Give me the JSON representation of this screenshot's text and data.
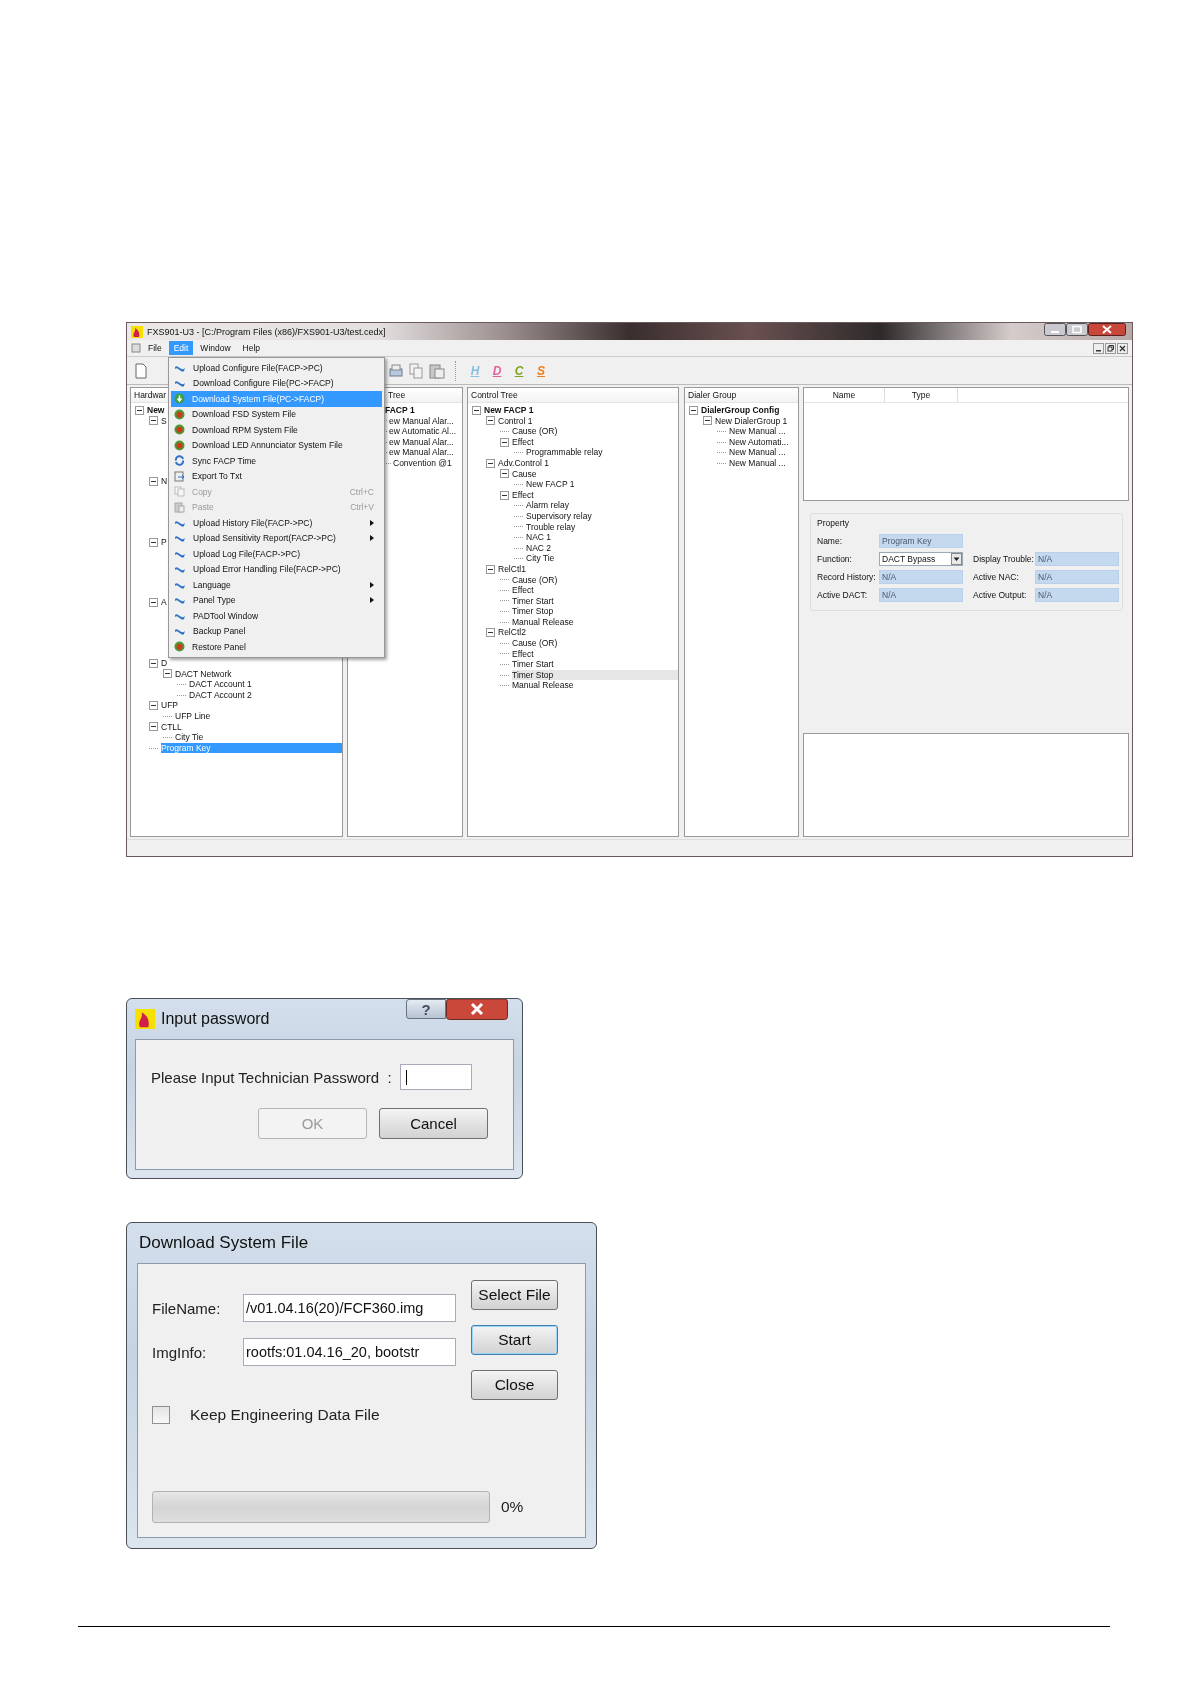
{
  "main_window": {
    "title": "FXS901-U3 - [C:/Program Files (x86)/FXS901-U3/test.cedx]",
    "menu_bar": [
      {
        "label": "File",
        "selected": false
      },
      {
        "label": "Edit",
        "selected": true
      },
      {
        "label": "Window",
        "selected": false
      },
      {
        "label": "Help",
        "selected": false
      }
    ],
    "toolbar_letters": [
      {
        "label": "H",
        "color": "#86bfe0"
      },
      {
        "label": "D",
        "color": "#e4609c"
      },
      {
        "label": "C",
        "color": "#7ea31c"
      },
      {
        "label": "S",
        "color": "#f07d18"
      }
    ],
    "edit_menu": [
      {
        "label": "Upload Configure File(FACP->PC)",
        "kind": "transfer",
        "selected": false,
        "disabled": false,
        "submenu": false
      },
      {
        "label": "Download Configure File(PC->FACP)",
        "kind": "transfer",
        "selected": false,
        "disabled": false,
        "submenu": false
      },
      {
        "label": "Download System File(PC->FACP)",
        "kind": "install",
        "selected": true,
        "disabled": false,
        "submenu": false
      },
      {
        "label": "Download FSD System File",
        "kind": "chip",
        "selected": false,
        "disabled": false,
        "submenu": false
      },
      {
        "label": "Download RPM System File",
        "kind": "chip",
        "selected": false,
        "disabled": false,
        "submenu": false
      },
      {
        "label": "Download LED Annunciator System File",
        "kind": "chip",
        "selected": false,
        "disabled": false,
        "submenu": false
      },
      {
        "label": "Sync FACP Time",
        "kind": "sync",
        "selected": false,
        "disabled": false,
        "submenu": false
      },
      {
        "label": "Export To Txt",
        "kind": "export",
        "selected": false,
        "disabled": false,
        "submenu": false
      },
      {
        "label": "Copy",
        "kind": "copy",
        "shortcut": "Ctrl+C",
        "selected": false,
        "disabled": true,
        "submenu": false
      },
      {
        "label": "Paste",
        "kind": "paste",
        "shortcut": "Ctrl+V",
        "selected": false,
        "disabled": true,
        "submenu": false
      },
      {
        "label": "Upload History File(FACP->PC)",
        "kind": "transfer",
        "selected": false,
        "disabled": false,
        "submenu": true
      },
      {
        "label": "Upload Sensitivity Report(FACP->PC)",
        "kind": "transfer",
        "selected": false,
        "disabled": false,
        "submenu": true
      },
      {
        "label": "Upload Log File(FACP->PC)",
        "kind": "transfer",
        "selected": false,
        "disabled": false,
        "submenu": false
      },
      {
        "label": "Upload Error Handling File(FACP->PC)",
        "kind": "transfer",
        "selected": false,
        "disabled": false,
        "submenu": false
      },
      {
        "label": "Language",
        "kind": "transfer",
        "selected": false,
        "disabled": false,
        "submenu": true
      },
      {
        "label": "Panel Type",
        "kind": "transfer",
        "selected": false,
        "disabled": false,
        "submenu": true
      },
      {
        "label": "PADTool Window",
        "kind": "transfer",
        "selected": false,
        "disabled": false,
        "submenu": false
      },
      {
        "label": "Backup Panel",
        "kind": "transfer",
        "selected": false,
        "disabled": false,
        "submenu": false
      },
      {
        "label": "Restore Panel",
        "kind": "chip",
        "selected": false,
        "disabled": false,
        "submenu": false
      }
    ],
    "hardware_tree": {
      "header": "Hardwar",
      "focused": true,
      "items": [
        {
          "label": "New",
          "expanded": true,
          "selected": false,
          "children": [
            {
              "label": "S",
              "expanded": true,
              "selected": false
            },
            {
              "label": "N",
              "expanded": true,
              "selected": false
            },
            {
              "label": "P",
              "expanded": true,
              "selected": false
            },
            {
              "label": "A",
              "expanded": true,
              "selected": false
            },
            {
              "label": "D",
              "expanded": true,
              "selected": false,
              "children": [
                {
                  "label": "DACT Network",
                  "expanded": true,
                  "selected": false,
                  "children": [
                    {
                      "label": "DACT Account 1",
                      "selected": false
                    },
                    {
                      "label": "DACT Account 2",
                      "selected": false
                    }
                  ]
                }
              ]
            },
            {
              "label": "UFP",
              "expanded": true,
              "selected": false,
              "children": [
                {
                  "label": "UFP Line",
                  "selected": false
                }
              ]
            },
            {
              "label": "CTLL",
              "expanded": true,
              "selected": false,
              "children": [
                {
                  "label": "City Tie",
                  "selected": false
                }
              ]
            },
            {
              "label": "Program Key",
              "selected": true
            }
          ]
        }
      ]
    },
    "data_tree": {
      "header": "Tree",
      "items": [
        {
          "label": "FACP 1",
          "selected": false,
          "children": [
            {
              "label": "ew Manual Alar...",
              "selected": false
            },
            {
              "label": "ew Automatic Al...",
              "selected": false
            },
            {
              "label": "ew Manual Alar...",
              "selected": false
            },
            {
              "label": "ew Manual Alar...",
              "selected": false,
              "children": [
                {
                  "label": "Convention @1",
                  "selected": false
                }
              ]
            }
          ]
        }
      ]
    },
    "control_tree": {
      "header": "Control Tree",
      "focused": false,
      "items": [
        {
          "label": "New FACP 1",
          "expanded": true,
          "selected": false,
          "children": [
            {
              "label": "Control 1",
              "expanded": true,
              "selected": false,
              "children": [
                {
                  "label": "Cause (OR)",
                  "selected": false
                },
                {
                  "label": "Effect",
                  "expanded": true,
                  "selected": false,
                  "children": [
                    {
                      "label": "Programmable relay",
                      "selected": false
                    }
                  ]
                }
              ]
            },
            {
              "label": "Adv.Control 1",
              "expanded": true,
              "selected": false,
              "children": [
                {
                  "label": "Cause",
                  "expanded": true,
                  "selected": false,
                  "children": [
                    {
                      "label": "New FACP 1",
                      "selected": false
                    }
                  ]
                },
                {
                  "label": "Effect",
                  "expanded": true,
                  "selected": false,
                  "children": [
                    {
                      "label": "Alarm relay",
                      "selected": false
                    },
                    {
                      "label": "Supervisory relay",
                      "selected": false
                    },
                    {
                      "label": "Trouble relay",
                      "selected": false
                    },
                    {
                      "label": "NAC 1",
                      "selected": false
                    },
                    {
                      "label": "NAC 2",
                      "selected": false
                    },
                    {
                      "label": "City Tie",
                      "selected": false
                    }
                  ]
                }
              ]
            },
            {
              "label": "RelCtl1",
              "expanded": true,
              "selected": false,
              "children": [
                {
                  "label": "Cause (OR)",
                  "selected": false
                },
                {
                  "label": "Effect",
                  "selected": false
                },
                {
                  "label": "Timer Start",
                  "selected": false
                },
                {
                  "label": "Timer Stop",
                  "selected": false
                },
                {
                  "label": "Manual Release",
                  "selected": false
                }
              ]
            },
            {
              "label": "RelCtl2",
              "expanded": true,
              "selected": false,
              "children": [
                {
                  "label": "Cause (OR)",
                  "selected": false
                },
                {
                  "label": "Effect",
                  "selected": false
                },
                {
                  "label": "Timer Start",
                  "selected": false
                },
                {
                  "label": "Timer Stop",
                  "selected": true
                },
                {
                  "label": "Manual Release",
                  "selected": false
                }
              ]
            }
          ]
        }
      ]
    },
    "dialer_tree": {
      "header": "Dialer Group",
      "items": [
        {
          "label": "DialerGroup Config",
          "expanded": true,
          "selected": false,
          "children": [
            {
              "label": "New DialerGroup 1",
              "expanded": true,
              "selected": false,
              "children": [
                {
                  "label": "New Manual ...",
                  "selected": false
                },
                {
                  "label": "New Automati...",
                  "selected": false
                },
                {
                  "label": "New Manual ...",
                  "selected": false
                },
                {
                  "label": "New Manual ...",
                  "selected": false
                }
              ]
            }
          ]
        }
      ]
    },
    "table": {
      "columns": [
        "Name",
        "Type"
      ]
    },
    "property": {
      "title": "Property",
      "fields": [
        {
          "label": "Name:",
          "value": "Program Key",
          "kind": "text",
          "disabled": true
        },
        {
          "label": "Function:",
          "value": "DACT Bypass",
          "kind": "combo",
          "disabled": false
        },
        {
          "label": "Display Trouble:",
          "value": "N/A",
          "kind": "text",
          "disabled": true
        },
        {
          "label": "Record History:",
          "value": "N/A",
          "kind": "text",
          "disabled": true
        },
        {
          "label": "Active NAC:",
          "value": "N/A",
          "kind": "text",
          "disabled": true
        },
        {
          "label": "Active DACT:",
          "value": "N/A",
          "kind": "text",
          "disabled": true
        },
        {
          "label": "Active Output:",
          "value": "N/A",
          "kind": "text",
          "disabled": true
        }
      ]
    }
  },
  "password_dialog": {
    "title": "Input password",
    "help_button": "?",
    "prompt": "Please Input Technician Password  :",
    "buttons": [
      {
        "label": "OK",
        "disabled": true
      },
      {
        "label": "Cancel",
        "disabled": false
      }
    ]
  },
  "download_dialog": {
    "title": "Download System File",
    "fields": [
      {
        "label": "FileName:",
        "value": "/v01.04.16(20)/FCF360.img"
      },
      {
        "label": "ImgInfo:",
        "value": "rootfs:01.04.16_20, bootstr"
      }
    ],
    "buttons": [
      {
        "label": "Select File",
        "focused": false
      },
      {
        "label": "Start",
        "focused": true
      },
      {
        "label": "Close",
        "focused": false
      }
    ],
    "checkbox": {
      "label": "Keep Engineering Data File",
      "checked": false
    },
    "progress": {
      "level": 0,
      "reading": "0%"
    }
  }
}
